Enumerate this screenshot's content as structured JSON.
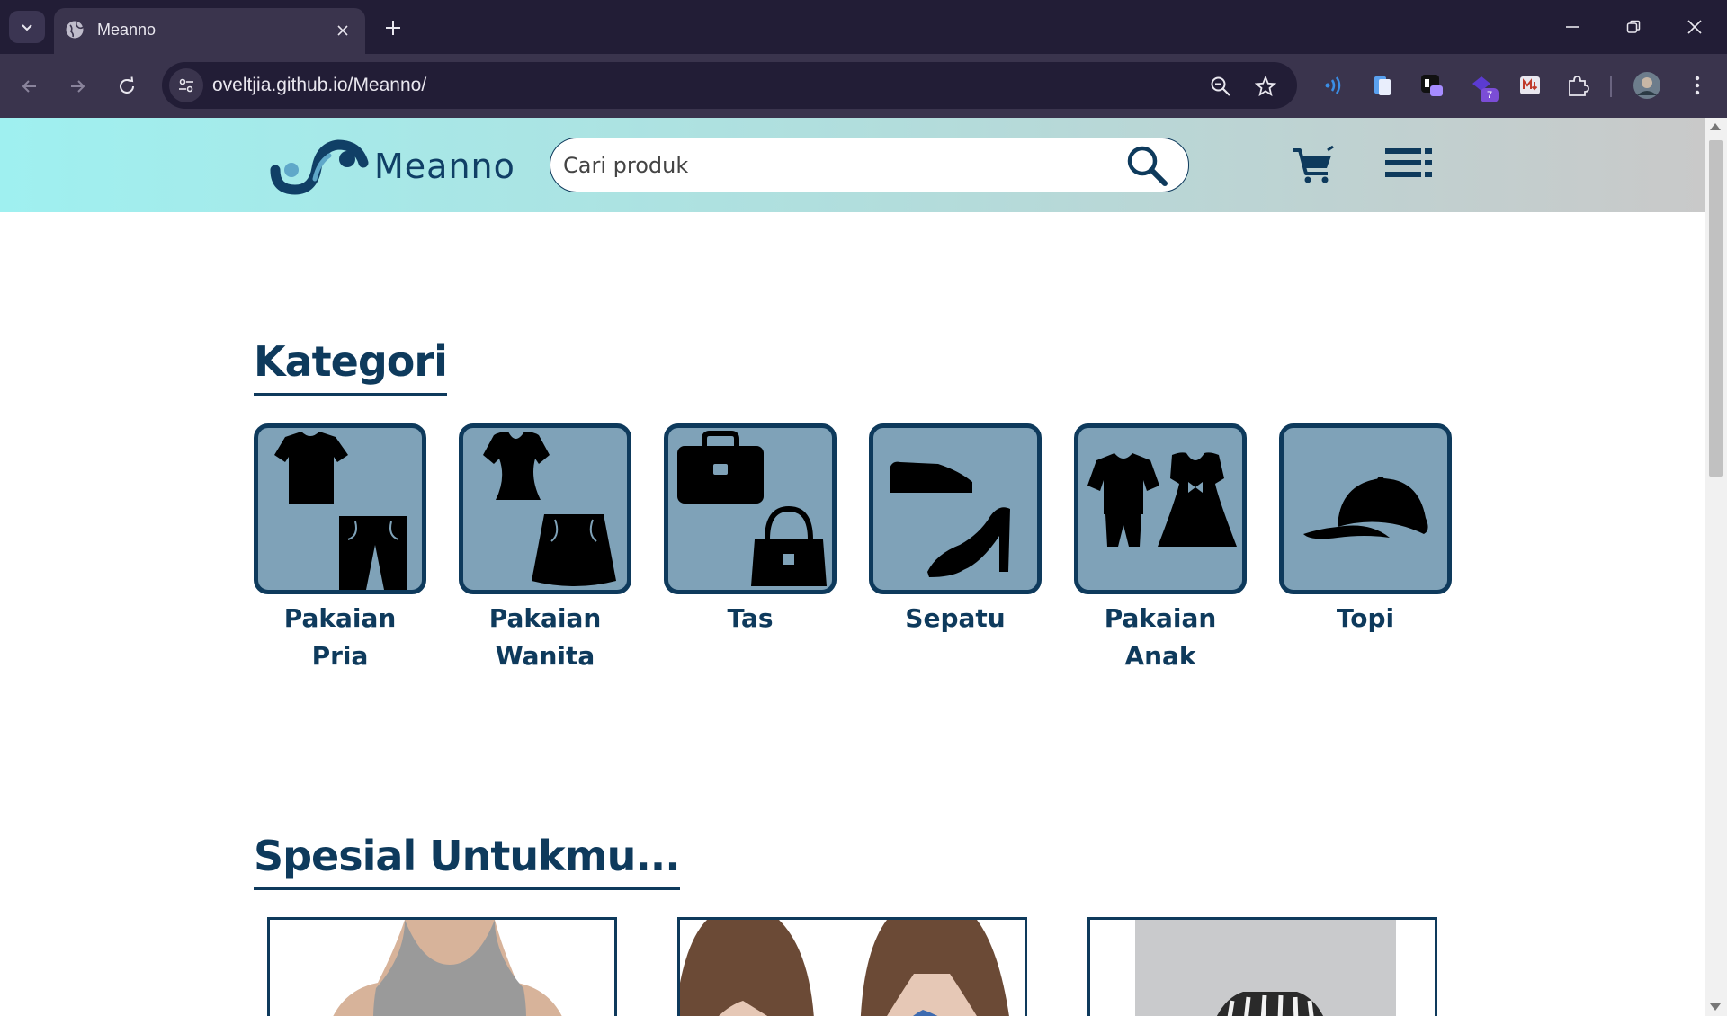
{
  "browser": {
    "tab_title": "Meanno",
    "url_host": "oveltjia.github.io",
    "url_path": "/Meanno/",
    "extension_badge": "7"
  },
  "site": {
    "logo_text": "Meanno",
    "search_placeholder": "Cari produk"
  },
  "categories_section": {
    "title": "Kategori",
    "items": [
      {
        "label": "Pakaian Pria",
        "icon": "men-clothing-icon"
      },
      {
        "label": "Pakaian Wanita",
        "icon": "women-clothing-icon"
      },
      {
        "label": "Tas",
        "icon": "bags-icon"
      },
      {
        "label": "Sepatu",
        "icon": "shoes-icon"
      },
      {
        "label": "Pakaian Anak",
        "icon": "kids-clothing-icon"
      },
      {
        "label": "Topi",
        "icon": "cap-icon"
      }
    ]
  },
  "special_section": {
    "title": "Spesial Untukmu..."
  },
  "colors": {
    "brand_dark": "#0e3a5c",
    "category_bg": "#7fa2b8",
    "header_gradient_start": "#9ff0f0",
    "header_gradient_end": "#c9c9c9"
  }
}
